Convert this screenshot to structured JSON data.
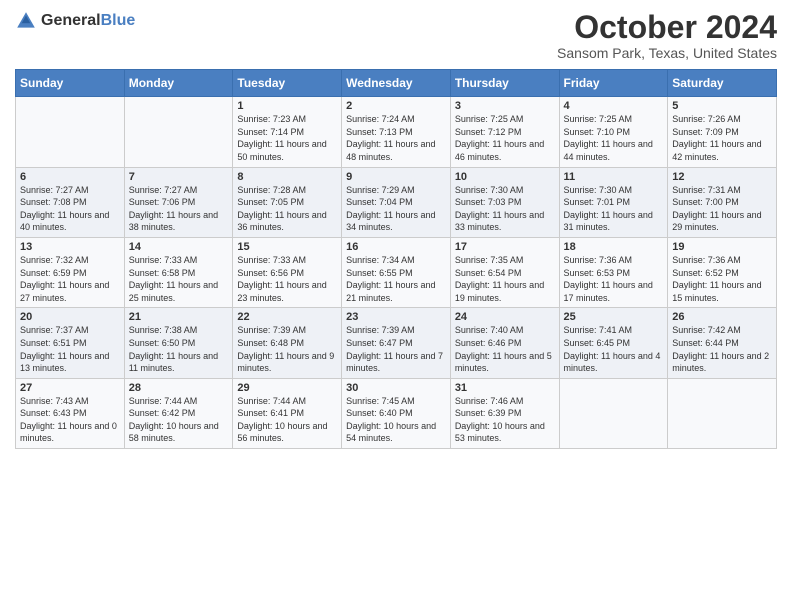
{
  "header": {
    "logo_general": "General",
    "logo_blue": "Blue",
    "main_title": "October 2024",
    "subtitle": "Sansom Park, Texas, United States"
  },
  "days_of_week": [
    "Sunday",
    "Monday",
    "Tuesday",
    "Wednesday",
    "Thursday",
    "Friday",
    "Saturday"
  ],
  "weeks": [
    [
      {
        "day": "",
        "sunrise": "",
        "sunset": "",
        "daylight": ""
      },
      {
        "day": "",
        "sunrise": "",
        "sunset": "",
        "daylight": ""
      },
      {
        "day": "1",
        "sunrise": "Sunrise: 7:23 AM",
        "sunset": "Sunset: 7:14 PM",
        "daylight": "Daylight: 11 hours and 50 minutes."
      },
      {
        "day": "2",
        "sunrise": "Sunrise: 7:24 AM",
        "sunset": "Sunset: 7:13 PM",
        "daylight": "Daylight: 11 hours and 48 minutes."
      },
      {
        "day": "3",
        "sunrise": "Sunrise: 7:25 AM",
        "sunset": "Sunset: 7:12 PM",
        "daylight": "Daylight: 11 hours and 46 minutes."
      },
      {
        "day": "4",
        "sunrise": "Sunrise: 7:25 AM",
        "sunset": "Sunset: 7:10 PM",
        "daylight": "Daylight: 11 hours and 44 minutes."
      },
      {
        "day": "5",
        "sunrise": "Sunrise: 7:26 AM",
        "sunset": "Sunset: 7:09 PM",
        "daylight": "Daylight: 11 hours and 42 minutes."
      }
    ],
    [
      {
        "day": "6",
        "sunrise": "Sunrise: 7:27 AM",
        "sunset": "Sunset: 7:08 PM",
        "daylight": "Daylight: 11 hours and 40 minutes."
      },
      {
        "day": "7",
        "sunrise": "Sunrise: 7:27 AM",
        "sunset": "Sunset: 7:06 PM",
        "daylight": "Daylight: 11 hours and 38 minutes."
      },
      {
        "day": "8",
        "sunrise": "Sunrise: 7:28 AM",
        "sunset": "Sunset: 7:05 PM",
        "daylight": "Daylight: 11 hours and 36 minutes."
      },
      {
        "day": "9",
        "sunrise": "Sunrise: 7:29 AM",
        "sunset": "Sunset: 7:04 PM",
        "daylight": "Daylight: 11 hours and 34 minutes."
      },
      {
        "day": "10",
        "sunrise": "Sunrise: 7:30 AM",
        "sunset": "Sunset: 7:03 PM",
        "daylight": "Daylight: 11 hours and 33 minutes."
      },
      {
        "day": "11",
        "sunrise": "Sunrise: 7:30 AM",
        "sunset": "Sunset: 7:01 PM",
        "daylight": "Daylight: 11 hours and 31 minutes."
      },
      {
        "day": "12",
        "sunrise": "Sunrise: 7:31 AM",
        "sunset": "Sunset: 7:00 PM",
        "daylight": "Daylight: 11 hours and 29 minutes."
      }
    ],
    [
      {
        "day": "13",
        "sunrise": "Sunrise: 7:32 AM",
        "sunset": "Sunset: 6:59 PM",
        "daylight": "Daylight: 11 hours and 27 minutes."
      },
      {
        "day": "14",
        "sunrise": "Sunrise: 7:33 AM",
        "sunset": "Sunset: 6:58 PM",
        "daylight": "Daylight: 11 hours and 25 minutes."
      },
      {
        "day": "15",
        "sunrise": "Sunrise: 7:33 AM",
        "sunset": "Sunset: 6:56 PM",
        "daylight": "Daylight: 11 hours and 23 minutes."
      },
      {
        "day": "16",
        "sunrise": "Sunrise: 7:34 AM",
        "sunset": "Sunset: 6:55 PM",
        "daylight": "Daylight: 11 hours and 21 minutes."
      },
      {
        "day": "17",
        "sunrise": "Sunrise: 7:35 AM",
        "sunset": "Sunset: 6:54 PM",
        "daylight": "Daylight: 11 hours and 19 minutes."
      },
      {
        "day": "18",
        "sunrise": "Sunrise: 7:36 AM",
        "sunset": "Sunset: 6:53 PM",
        "daylight": "Daylight: 11 hours and 17 minutes."
      },
      {
        "day": "19",
        "sunrise": "Sunrise: 7:36 AM",
        "sunset": "Sunset: 6:52 PM",
        "daylight": "Daylight: 11 hours and 15 minutes."
      }
    ],
    [
      {
        "day": "20",
        "sunrise": "Sunrise: 7:37 AM",
        "sunset": "Sunset: 6:51 PM",
        "daylight": "Daylight: 11 hours and 13 minutes."
      },
      {
        "day": "21",
        "sunrise": "Sunrise: 7:38 AM",
        "sunset": "Sunset: 6:50 PM",
        "daylight": "Daylight: 11 hours and 11 minutes."
      },
      {
        "day": "22",
        "sunrise": "Sunrise: 7:39 AM",
        "sunset": "Sunset: 6:48 PM",
        "daylight": "Daylight: 11 hours and 9 minutes."
      },
      {
        "day": "23",
        "sunrise": "Sunrise: 7:39 AM",
        "sunset": "Sunset: 6:47 PM",
        "daylight": "Daylight: 11 hours and 7 minutes."
      },
      {
        "day": "24",
        "sunrise": "Sunrise: 7:40 AM",
        "sunset": "Sunset: 6:46 PM",
        "daylight": "Daylight: 11 hours and 5 minutes."
      },
      {
        "day": "25",
        "sunrise": "Sunrise: 7:41 AM",
        "sunset": "Sunset: 6:45 PM",
        "daylight": "Daylight: 11 hours and 4 minutes."
      },
      {
        "day": "26",
        "sunrise": "Sunrise: 7:42 AM",
        "sunset": "Sunset: 6:44 PM",
        "daylight": "Daylight: 11 hours and 2 minutes."
      }
    ],
    [
      {
        "day": "27",
        "sunrise": "Sunrise: 7:43 AM",
        "sunset": "Sunset: 6:43 PM",
        "daylight": "Daylight: 11 hours and 0 minutes."
      },
      {
        "day": "28",
        "sunrise": "Sunrise: 7:44 AM",
        "sunset": "Sunset: 6:42 PM",
        "daylight": "Daylight: 10 hours and 58 minutes."
      },
      {
        "day": "29",
        "sunrise": "Sunrise: 7:44 AM",
        "sunset": "Sunset: 6:41 PM",
        "daylight": "Daylight: 10 hours and 56 minutes."
      },
      {
        "day": "30",
        "sunrise": "Sunrise: 7:45 AM",
        "sunset": "Sunset: 6:40 PM",
        "daylight": "Daylight: 10 hours and 54 minutes."
      },
      {
        "day": "31",
        "sunrise": "Sunrise: 7:46 AM",
        "sunset": "Sunset: 6:39 PM",
        "daylight": "Daylight: 10 hours and 53 minutes."
      },
      {
        "day": "",
        "sunrise": "",
        "sunset": "",
        "daylight": ""
      },
      {
        "day": "",
        "sunrise": "",
        "sunset": "",
        "daylight": ""
      }
    ]
  ]
}
